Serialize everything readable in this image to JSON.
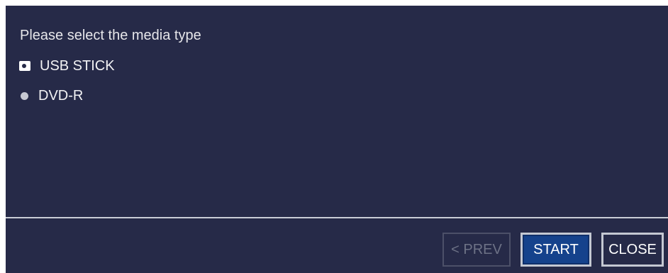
{
  "dialog": {
    "prompt": "Please select the media type",
    "options": [
      {
        "label": "USB STICK",
        "selected": true
      },
      {
        "label": "DVD-R",
        "selected": false
      }
    ],
    "buttons": {
      "prev": {
        "label": "< PREV",
        "enabled": false
      },
      "start": {
        "label": "START",
        "focused": true
      },
      "close": {
        "label": "CLOSE"
      }
    }
  },
  "colors": {
    "background": "#262a48",
    "start_button": "#15428c",
    "text": "#f2f2f4",
    "divider": "#c9cdd6",
    "disabled_text": "#6d7286"
  }
}
